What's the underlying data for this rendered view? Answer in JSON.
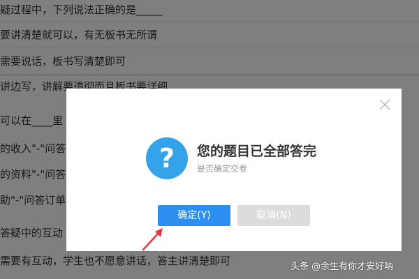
{
  "background": {
    "lines": [
      "疑过程中，下列说法正确的是_____",
      "要讲清楚就可以，有无板书无所谓",
      "需要说话，板书写清楚即可",
      "讲边写，讲解要透彻而且板书要详细",
      "可以在____里",
      "的收入\"-\"问答",
      "的资料\"-\"问答",
      "助\"-\"问答订单",
      "答疑中的互动",
      "需要有互动，学生也不愿意讲话，答主讲清楚即可"
    ]
  },
  "dialog": {
    "title": "您的题目已全部答完",
    "subtitle": "是否确定交卷",
    "confirm_label": "确定(Y)",
    "cancel_label": "取消(N)"
  },
  "watermark": "头条 @余生有你才安好呐",
  "colors": {
    "confirm": "#2c8ef0",
    "icon": "#35a3ea",
    "arrow": "#e8333a"
  }
}
